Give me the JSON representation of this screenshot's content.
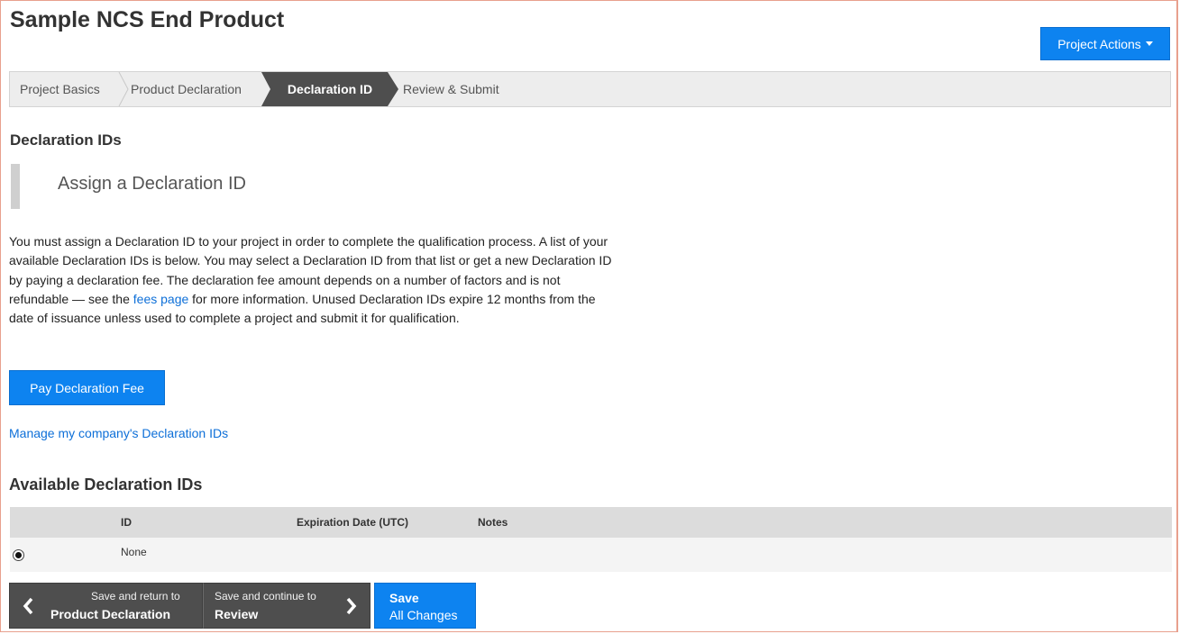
{
  "page": {
    "title": "Sample NCS End Product",
    "project_actions_label": "Project Actions"
  },
  "wizard": {
    "steps": [
      {
        "label": "Project Basics"
      },
      {
        "label": "Product Declaration"
      },
      {
        "label": "Declaration ID"
      },
      {
        "label": "Review & Submit"
      }
    ],
    "active_step": "Declaration ID"
  },
  "declaration": {
    "heading": "Declaration IDs",
    "callout_title": "Assign a Declaration ID",
    "body_part1": "You must assign a Declaration ID to your project in order to complete the qualification process. A list of your available Declaration IDs is below. You may select a Declaration ID from that list or get a new Declaration ID by paying a declaration fee. The declaration fee amount depends on a number of factors and is not refundable — see the ",
    "fees_link": "fees page",
    "body_part2": " for more information. Unused Declaration IDs expire 12 months from the date of issuance unless used to complete a project and submit it for qualification.",
    "pay_button": "Pay Declaration Fee",
    "manage_link": "Manage my company's Declaration IDs"
  },
  "available": {
    "heading": "Available Declaration IDs",
    "columns": [
      "ID",
      "Expiration Date (UTC)",
      "Notes"
    ],
    "rows": [
      {
        "selected": true,
        "id": "None",
        "expiration": "",
        "notes": ""
      }
    ]
  },
  "footer_nav": {
    "back_small": "Save and return to",
    "back_big": "Product Declaration",
    "next_small": "Save and continue to",
    "next_big": "Review",
    "save_line1": "Save",
    "save_line2": "All Changes"
  },
  "colors": {
    "primary_button": "#0d83f0",
    "active_step": "#4e4e4e",
    "link": "#0d6fd8",
    "frame_border": "#e8a08e"
  }
}
